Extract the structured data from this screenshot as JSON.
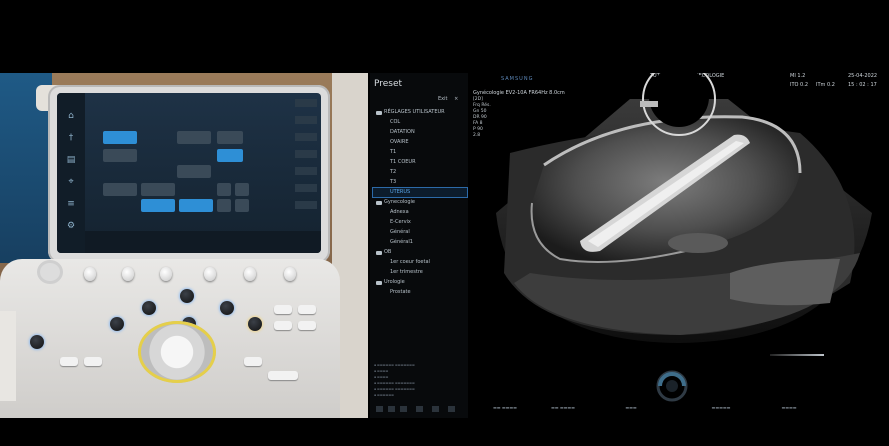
{
  "preset_panel": {
    "title": "Preset",
    "exit_label": "Exit",
    "close_glyph": "×",
    "groups": [
      {
        "label": "RÉGLAGES UTILISATEUR",
        "items": [
          "COL",
          "DATATION",
          "OVAIRE",
          "T1",
          "T1 COEUR",
          "T2",
          "T3",
          "UTERUS"
        ]
      },
      {
        "label": "Gynecologie",
        "items": [
          "Adnexa",
          "E-Cervix",
          "Général",
          "Général1"
        ]
      },
      {
        "label": "OB",
        "items": [
          "1er coeur foetal",
          "1er trimestre"
        ]
      },
      {
        "label": "Urologie",
        "items": [
          "Prostate"
        ]
      }
    ],
    "selected_item": "UTERUS"
  },
  "ultrasound": {
    "brand": "SAMSUNG",
    "title": "TUTORIEL 3D - GYNECOLOGIE",
    "date": "25-04-2022",
    "time": "15 : 02 : 17",
    "mi": "MI 1.2",
    "ito": "ITO 0.2",
    "itm": "ITm 0.2",
    "probe_line": "Gynécologie   EV2-10A   FR64Hz   8.0cm",
    "params": [
      "[2D]",
      "Frq  Rés.",
      "Gn   50",
      "DR   90",
      "FA   8",
      "P    90",
      "2.8"
    ]
  },
  "colors": {
    "accent_blue": "#2e8fd6",
    "selection_border": "#2c6aa8",
    "brand_blue": "#5d88b9",
    "trackball_ring": "#e5cf4a"
  }
}
